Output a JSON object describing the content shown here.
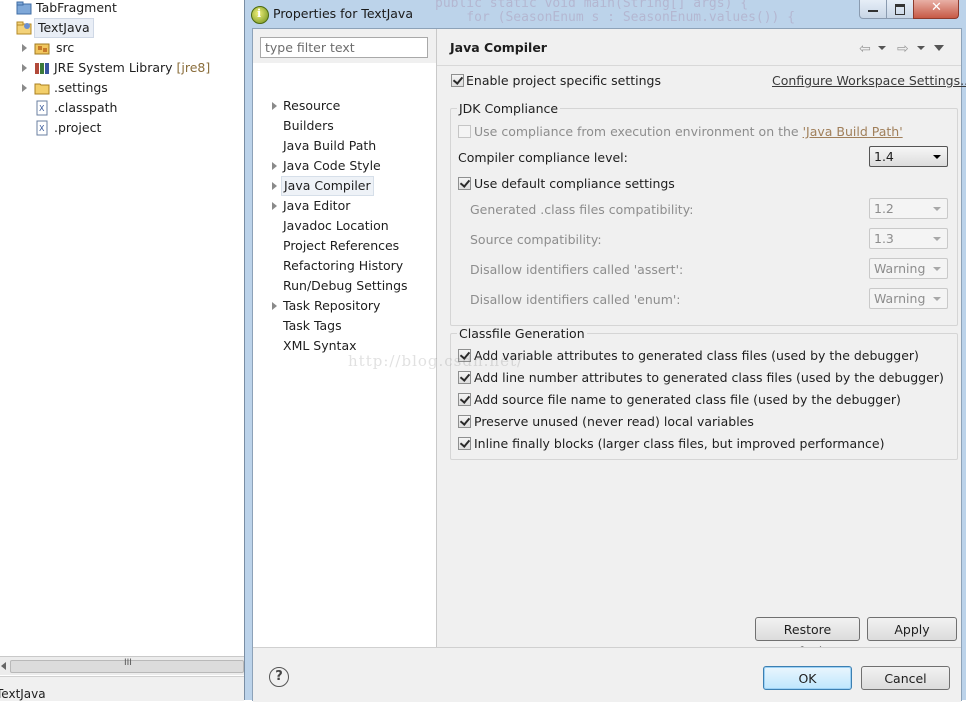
{
  "explorer": {
    "items": [
      {
        "label": "TabFragment",
        "decoration": ""
      },
      {
        "label": "TextJava",
        "decoration": ""
      },
      {
        "label": "src",
        "decoration": ""
      },
      {
        "label": "JRE System Library",
        "decoration": "[jre8]"
      },
      {
        "label": ".settings",
        "decoration": ""
      },
      {
        "label": ".classpath",
        "decoration": ""
      },
      {
        "label": ".project",
        "decoration": ""
      }
    ],
    "scroll_grip": "III",
    "status_text": "TextJava"
  },
  "dialog": {
    "title": "Properties for TextJava",
    "filter_placeholder": "type filter text",
    "nav": [
      "Resource",
      "Builders",
      "Java Build Path",
      "Java Code Style",
      "Java Compiler",
      "Java Editor",
      "Javadoc Location",
      "Project References",
      "Refactoring History",
      "Run/Debug Settings",
      "Task Repository",
      "Task Tags",
      "XML Syntax"
    ],
    "page": {
      "title": "Java Compiler",
      "enable_specific": "Enable project specific settings",
      "configure_link": "Configure Workspace Settings...",
      "jdk_group": "JDK Compliance",
      "use_ee_prefix": "Use compliance from execution environment on the ",
      "use_ee_link": "'Java Build Path'",
      "compliance_level_label": "Compiler compliance level:",
      "compliance_level_value": "1.4",
      "use_default": "Use default compliance settings",
      "generated_label": "Generated .class files compatibility:",
      "generated_value": "1.2",
      "source_label": "Source compatibility:",
      "source_value": "1.3",
      "assert_label": "Disallow identifiers called 'assert':",
      "assert_value": "Warning",
      "enum_label": "Disallow identifiers called 'enum':",
      "enum_value": "Warning",
      "classfile_group": "Classfile Generation",
      "classfile_options": [
        "Add variable attributes to generated class files (used by the debugger)",
        "Add line number attributes to generated class files (used by the debugger)",
        "Add source file name to generated class file (used by the debugger)",
        "Preserve unused (never read) local variables",
        "Inline finally blocks (larger class files, but improved performance)"
      ]
    },
    "restore_defaults": "Restore Defaults",
    "apply": "Apply",
    "ok": "OK",
    "cancel": "Cancel",
    "help_glyph": "?"
  },
  "background": {
    "code_line1": "public static void main(String[] args) {",
    "code_line2": "    for (SeasonEnum s : SeasonEnum.values()) {",
    "watermark": "http://blog.csdn.net/"
  }
}
